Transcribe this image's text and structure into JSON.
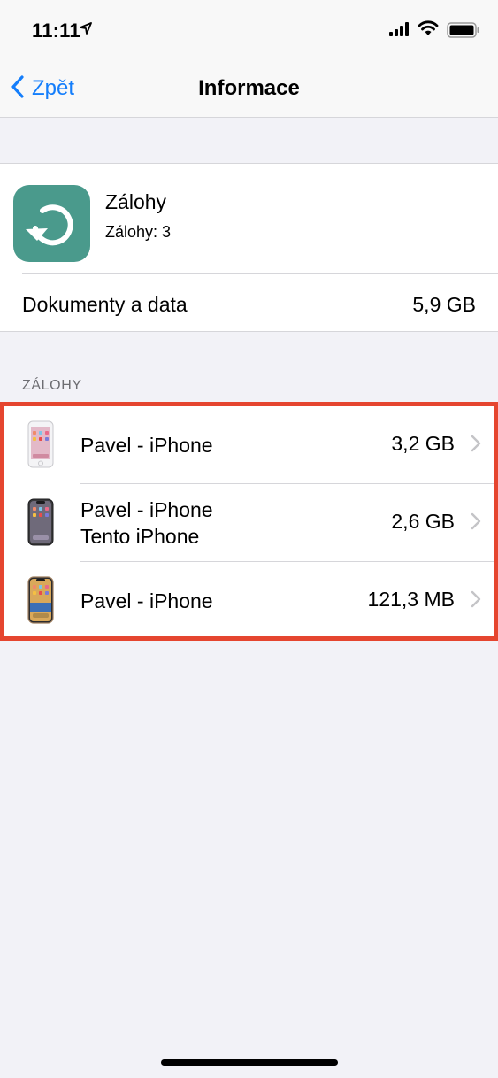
{
  "status_bar": {
    "time": "11:11",
    "location_icon": "location-arrow-icon",
    "signal_icon": "cellular-signal-icon",
    "wifi_icon": "wifi-icon",
    "battery_icon": "battery-icon"
  },
  "nav": {
    "back_label": "Zpět",
    "title": "Informace",
    "accent_color": "#147efb"
  },
  "app": {
    "name": "Zálohy",
    "subtitle": "Zálohy: 3",
    "icon": "backup-restore-icon",
    "icon_color": "#4a9a8c"
  },
  "documents": {
    "label": "Dokumenty a data",
    "value": "5,9 GB"
  },
  "backups": {
    "header": "ZÁLOHY",
    "highlight_color": "#e5452f",
    "items": [
      {
        "name": "Pavel - iPhone",
        "subtitle": "",
        "size": "3,2 GB",
        "device_icon": "iphone-home-button-icon"
      },
      {
        "name": "Pavel - iPhone",
        "subtitle": "Tento iPhone",
        "size": "2,6 GB",
        "device_icon": "iphone-notch-icon"
      },
      {
        "name": "Pavel - iPhone",
        "subtitle": "",
        "size": "121,3 MB",
        "device_icon": "iphone-notch-gold-icon"
      }
    ]
  }
}
